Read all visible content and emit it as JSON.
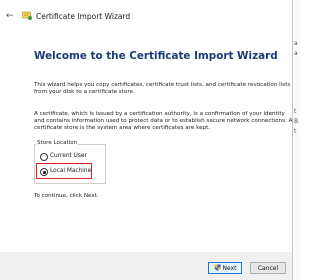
{
  "window": {
    "title": "Certificate Import Wizard",
    "back_icon": "back-arrow-icon",
    "app_icon": "certificate-icon"
  },
  "content": {
    "heading": "Welcome to the Certificate Import Wizard",
    "paragraph1": "This wizard helps you copy certificates, certificate trust lists, and certificate revocation lists from your disk to a certificate store.",
    "paragraph2": "A certificate, which is issued by a certification authority, is a confirmation of your identity and contains information used to protect data or to establish secure network connections. A certificate store is the system area where certificates are kept.",
    "store_location": {
      "legend": "Store Location",
      "options": [
        {
          "label": "Current User",
          "selected": false
        },
        {
          "label": "Local Machine",
          "selected": true
        }
      ],
      "highlight_color": "#e02020"
    },
    "continue_text": "To continue, click Next."
  },
  "buttons": {
    "next": "Next",
    "next_icon": "uac-shield-icon",
    "cancel": "Cancel"
  },
  "background_window_fragments": [
    "a",
    "a",
    "t",
    "B",
    "t"
  ],
  "colors": {
    "heading": "#1c3a78",
    "accent": "#2a74cf"
  }
}
